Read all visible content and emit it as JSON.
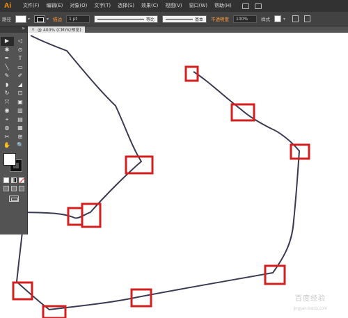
{
  "app": {
    "logo": "Ai"
  },
  "menu": {
    "items": [
      "文件(F)",
      "编辑(E)",
      "对象(O)",
      "文字(T)",
      "选择(S)",
      "效果(C)",
      "视图(V)",
      "窗口(W)",
      "帮助(H)"
    ]
  },
  "control": {
    "selection_label": "路径",
    "stroke_label": "描边",
    "stroke_weight": "1 pt",
    "profile_label": "等比",
    "brush_label": "基本",
    "opacity_label": "不透明度",
    "opacity_value": "100%",
    "style_label": "样式"
  },
  "document": {
    "tab_title": "@ 400% (CMYK/预览)",
    "close_glyph": "×"
  },
  "tools": [
    "▶",
    "◁",
    "✱",
    "⊙",
    "✒",
    "T",
    "╲",
    "▭",
    "✎",
    "✐",
    "◗",
    "◢",
    "↻",
    "⊡",
    "⤧",
    "▣",
    "◉",
    "▥",
    "⌖",
    "▤",
    "◍",
    "▦",
    "✂",
    "⊞",
    "✋",
    "🔍"
  ],
  "colors": {
    "path_stroke": "#3a3a52",
    "marker": "#d41f1f",
    "ui_dark": "#323232",
    "ui_mid": "#535353",
    "accent": "#ff9a00"
  },
  "watermark": {
    "text": "百度经验",
    "sub": "jingyan.baidu.com"
  }
}
